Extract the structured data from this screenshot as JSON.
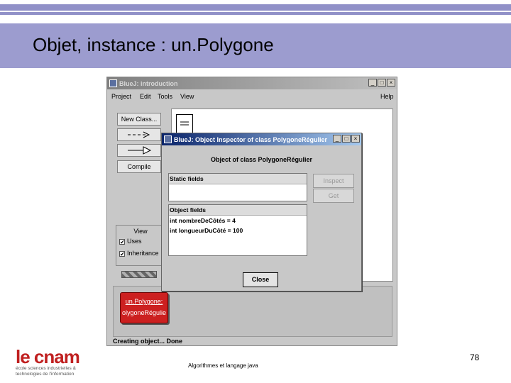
{
  "slide": {
    "title": "Objet, instance : un.Polygone",
    "page_number": "78",
    "footer_text": "Algorithmes et langage java",
    "logo": {
      "main": "le cnam",
      "sub1": "école sciences industrielles &",
      "sub2": "technologies de l'information"
    }
  },
  "bluej": {
    "window_title": "BlueJ:  introduction",
    "menu": [
      "Project",
      "Edit",
      "Tools",
      "View",
      "Help"
    ],
    "side_buttons": {
      "new_class": "New Class...",
      "arrow1": "--->",
      "arrow2": "—▷",
      "compile": "Compile"
    },
    "view_panel": {
      "label": "View",
      "uses": "Uses",
      "inheritance": "Inheritance"
    },
    "object": {
      "name": "un.Polygone:",
      "class": "olygoneRégulie"
    },
    "status": "Creating object... Done"
  },
  "inspector": {
    "window_title": "BlueJ:  Object Inspector of class PolygoneRégulier",
    "heading": "Object of class PolygoneRégulier",
    "static_fields_label": "Static fields",
    "object_fields_label": "Object fields",
    "fields": [
      "int nombreDeCôtés = 4",
      "int longueurDuCôté = 100"
    ],
    "inspect_label": "Inspect",
    "get_label": "Get",
    "close_label": "Close"
  },
  "colors": {
    "slide_band": "#9c9ccf",
    "object_red": "#cc2020",
    "titlebar": "#0a246a"
  }
}
